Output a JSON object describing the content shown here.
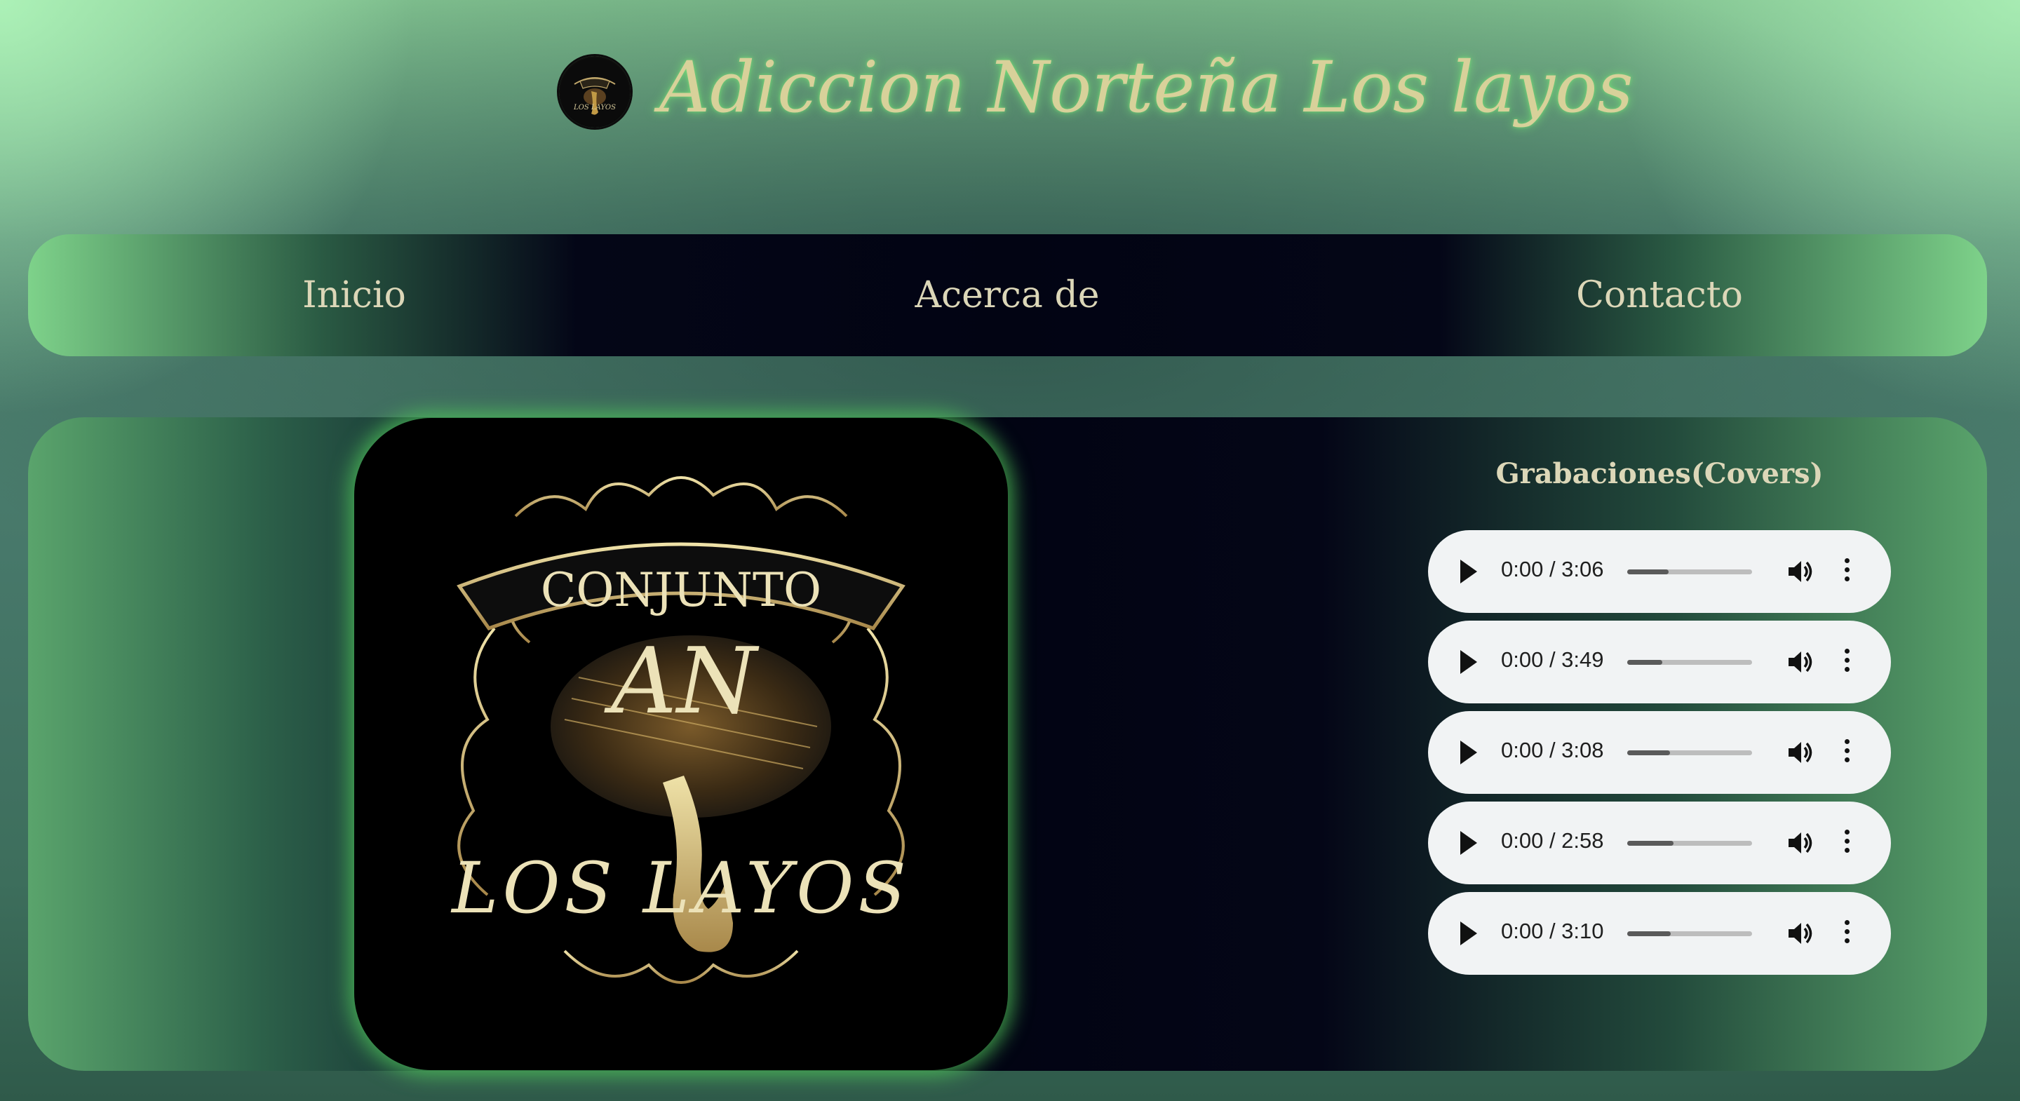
{
  "header": {
    "logo_text": "LOS LAYOS",
    "title": "Adiccion Norteña Los layos"
  },
  "nav": {
    "items": [
      {
        "label": "Inicio"
      },
      {
        "label": "Acerca de"
      },
      {
        "label": "Contacto"
      }
    ]
  },
  "album": {
    "line1": "CONJUNTO",
    "monogram": "AN",
    "line2": "LOS LAYOS"
  },
  "recordings": {
    "title": "Grabaciones(Covers)",
    "tracks": [
      {
        "time": "0:00 / 3:06",
        "buffered": 0.33
      },
      {
        "time": "0:00 / 3:49",
        "buffered": 0.28
      },
      {
        "time": "0:00 / 3:08",
        "buffered": 0.34
      },
      {
        "time": "0:00 / 2:58",
        "buffered": 0.37
      },
      {
        "time": "0:00 / 3:10",
        "buffered": 0.35
      }
    ]
  },
  "colors": {
    "accent_green": "#7ed28a",
    "gold_text": "#d8d19a",
    "panel_dark": "#020413",
    "player_bg": "#f1f3f4"
  }
}
